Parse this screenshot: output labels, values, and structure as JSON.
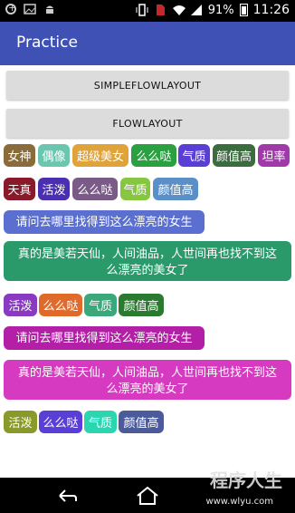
{
  "status_bar": {
    "battery_text": "91%",
    "time": "11:26"
  },
  "app_bar": {
    "title": "Practice"
  },
  "buttons": {
    "simple_flow_layout": "SIMPLEFLOWLAYOUT",
    "flow_layout": "FLOWLAYOUT"
  },
  "colors": {
    "app_bar": "#3f51b5",
    "button_bg": "#dcdcdc"
  },
  "tags_row1": [
    {
      "text": "女神",
      "color": "#8a6b3a"
    },
    {
      "text": "偶像",
      "color": "#6bc6b0"
    },
    {
      "text": "超级美女",
      "color": "#e0a33a"
    },
    {
      "text": "么么哒",
      "color": "#2aa040"
    },
    {
      "text": "气质",
      "color": "#5a3fd6"
    },
    {
      "text": "颜值高",
      "color": "#3c6b3f"
    },
    {
      "text": "坦率",
      "color": "#a03aa8"
    }
  ],
  "tags_row2": [
    {
      "text": "天真",
      "color": "#8a1a2a"
    },
    {
      "text": "活泼",
      "color": "#4a2fb0"
    },
    {
      "text": "么么哒",
      "color": "#7a5a86"
    },
    {
      "text": "气质",
      "color": "#86c640"
    },
    {
      "text": "颜值高",
      "color": "#5a8fc8"
    }
  ],
  "tag_long1": {
    "text": "请问去哪里找得到这么漂亮的女生",
    "color": "#5a6fd0"
  },
  "tag_long2": {
    "text": "真的是美若天仙，人间油品，人世间再也找不到这么漂亮的美女了",
    "color": "#2a9a6a"
  },
  "tags_row3": [
    {
      "text": "活泼",
      "color": "#8a3ac0"
    },
    {
      "text": "么么哒",
      "color": "#e06a2a"
    },
    {
      "text": "气质",
      "color": "#3aa87a"
    },
    {
      "text": "颜值高",
      "color": "#2a7a30"
    }
  ],
  "tag_long3": {
    "text": "请问去哪里找得到这么漂亮的女生",
    "color": "#b41fa8"
  },
  "tag_long4": {
    "text": "真的是美若天仙，人间油品，人世间再也找不到这么漂亮的美女了",
    "color": "#d63ac0"
  },
  "tags_row4": [
    {
      "text": "活泼",
      "color": "#8a9a2a"
    },
    {
      "text": "么么哒",
      "color": "#5a3fd6"
    },
    {
      "text": "气质",
      "color": "#2ad6b0"
    },
    {
      "text": "颜值高",
      "color": "#4a5a9a"
    }
  ],
  "watermark": {
    "line1": "程序人生",
    "line2": "www.wlyu.com"
  }
}
